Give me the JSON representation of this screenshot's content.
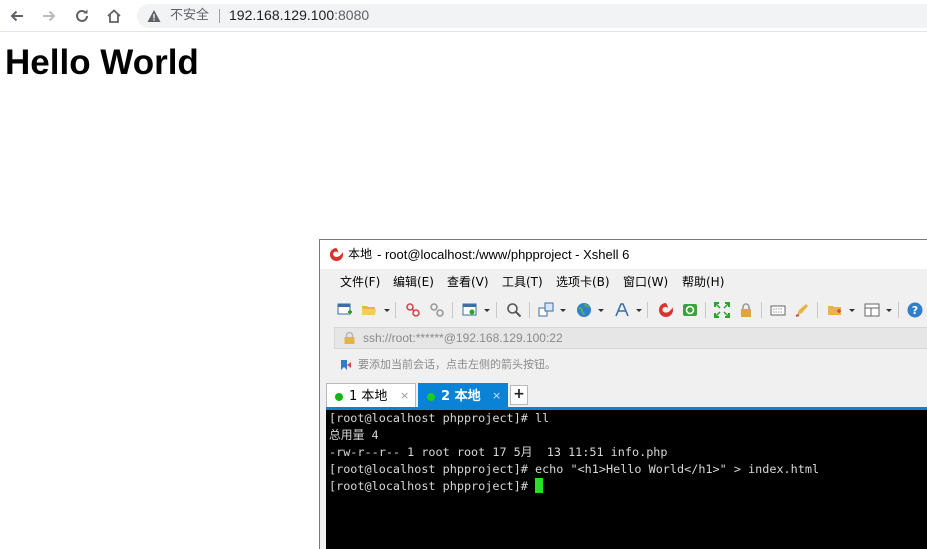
{
  "browser": {
    "security_label": "不安全",
    "url_host": "192.168.129.100",
    "url_port": ":8080"
  },
  "page": {
    "heading": "Hello World"
  },
  "xshell": {
    "title_prefix": "本地",
    "title": " - root@localhost:/www/phpproject - Xshell 6",
    "menu": [
      "文件(F)",
      "编辑(E)",
      "查看(V)",
      "工具(T)",
      "选项卡(B)",
      "窗口(W)",
      "帮助(H)"
    ],
    "address": "ssh://root:******@192.168.129.100:22",
    "hint": "要添加当前会话，点击左侧的箭头按钮。",
    "tabs": [
      {
        "label": "1 本地",
        "close": "×"
      },
      {
        "label": "2 本地",
        "close": "×"
      }
    ],
    "tab_add": "+",
    "terminal_lines": [
      "[root@localhost phpproject]# ll",
      "总用量 4",
      "-rw-r--r-- 1 root root 17 5月  13 11:51 info.php",
      "[root@localhost phpproject]# echo \"<h1>Hello World</h1>\" > index.html",
      "[root@localhost phpproject]# "
    ]
  },
  "colors": {
    "tab_active": "#0a83d6",
    "cursor": "#22e322",
    "terminal_bg": "#000000"
  }
}
